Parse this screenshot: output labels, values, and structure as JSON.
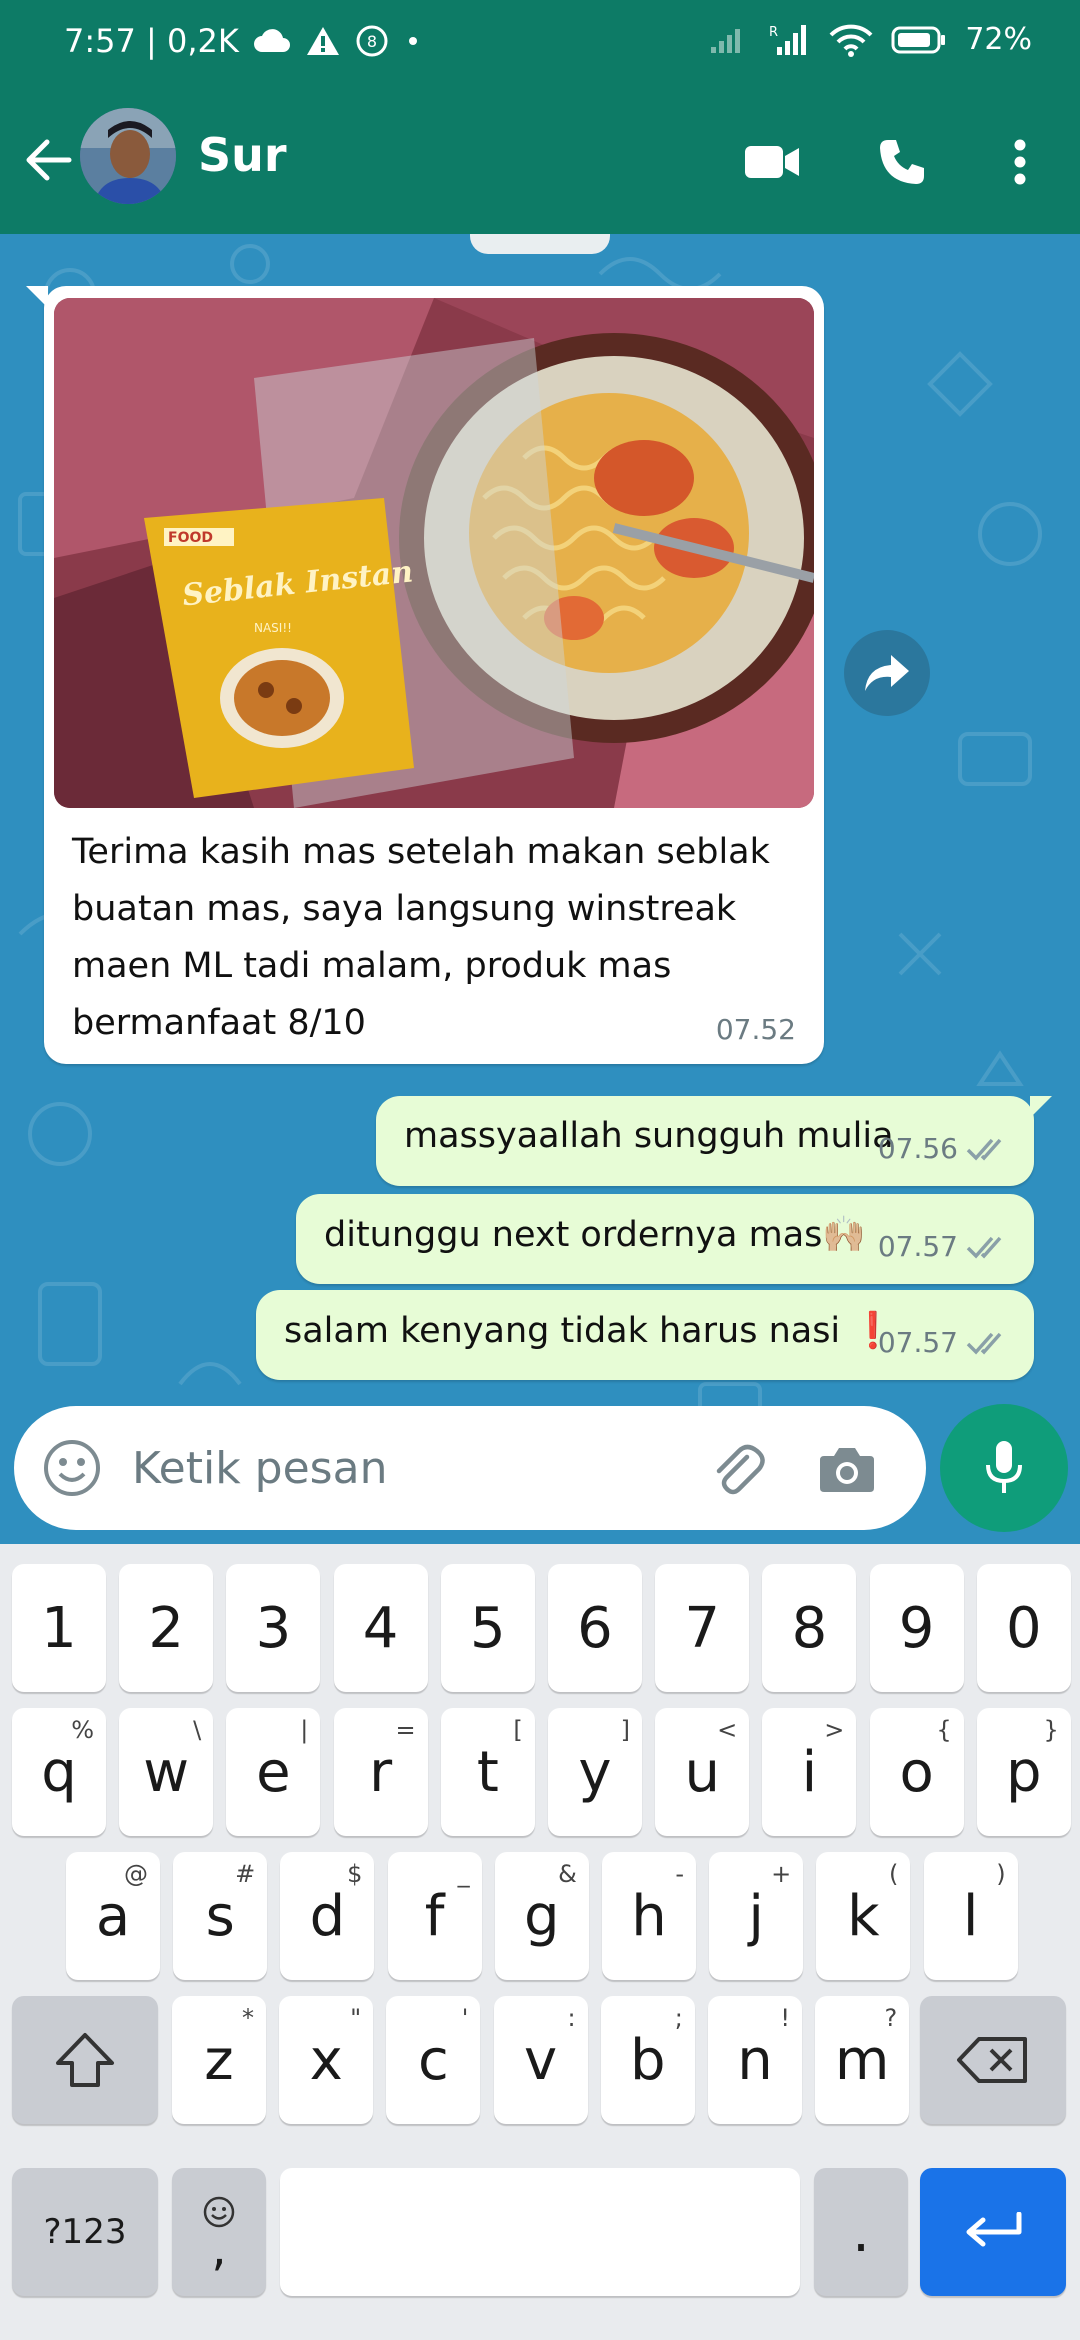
{
  "status_bar": {
    "time_info": "7:57 | 0,2K",
    "battery": "72%",
    "icons": [
      "cloud-icon",
      "warning-icon",
      "data-saver-icon",
      "dot-icon",
      "signal-icon",
      "signal-r-icon",
      "wifi-icon",
      "battery-icon"
    ]
  },
  "app_bar": {
    "contact_name": "Sur",
    "icons": [
      "back-arrow-icon",
      "video-call-icon",
      "phone-icon",
      "more-vert-icon"
    ]
  },
  "chat": {
    "incoming": {
      "text": "Terima kasih mas setelah makan seblak buatan mas, saya langsung winstreak maen ML tadi malam, produk mas bermanfaat 8/10",
      "time": "07.52",
      "photo_label_brand": "FOOD",
      "photo_label_title": "Seblak Instan",
      "photo_label_sub": "NASI!!"
    },
    "outgoing": [
      {
        "text": "massyaallah sungguh mulia",
        "time": "07.56"
      },
      {
        "text": "ditunggu next ordernya mas🙌🏼",
        "time": "07.57"
      },
      {
        "text": "salam kenyang tidak harus nasi ❗",
        "time": "07.57"
      }
    ]
  },
  "composer": {
    "placeholder": "Ketik pesan"
  },
  "keyboard": {
    "row1": [
      {
        "k": "1"
      },
      {
        "k": "2"
      },
      {
        "k": "3"
      },
      {
        "k": "4"
      },
      {
        "k": "5"
      },
      {
        "k": "6"
      },
      {
        "k": "7"
      },
      {
        "k": "8"
      },
      {
        "k": "9"
      },
      {
        "k": "0"
      }
    ],
    "row2": [
      {
        "k": "q",
        "s": "%"
      },
      {
        "k": "w",
        "s": "\\"
      },
      {
        "k": "e",
        "s": "|"
      },
      {
        "k": "r",
        "s": "="
      },
      {
        "k": "t",
        "s": "["
      },
      {
        "k": "y",
        "s": "]"
      },
      {
        "k": "u",
        "s": "<"
      },
      {
        "k": "i",
        "s": ">"
      },
      {
        "k": "o",
        "s": "{"
      },
      {
        "k": "p",
        "s": "}"
      }
    ],
    "row3": [
      {
        "k": "a",
        "s": "@"
      },
      {
        "k": "s",
        "s": "#"
      },
      {
        "k": "d",
        "s": "$"
      },
      {
        "k": "f",
        "s": "_"
      },
      {
        "k": "g",
        "s": "&"
      },
      {
        "k": "h",
        "s": "-"
      },
      {
        "k": "j",
        "s": "+"
      },
      {
        "k": "k",
        "s": "("
      },
      {
        "k": "l",
        "s": ")"
      }
    ],
    "row4": [
      {
        "k": "z",
        "s": "*"
      },
      {
        "k": "x",
        "s": "\""
      },
      {
        "k": "c",
        "s": "'"
      },
      {
        "k": "v",
        "s": ":"
      },
      {
        "k": "b",
        "s": ";"
      },
      {
        "k": "n",
        "s": "!"
      },
      {
        "k": "m",
        "s": "?"
      }
    ],
    "symbols_label": "?123",
    "comma_label": ",",
    "period_label": "."
  },
  "colors": {
    "header": "#0d7b66",
    "chat_bg": "#2f8fbf",
    "outgoing_bubble": "#e7fcd6",
    "mic_button": "#0f9d7a",
    "read_ticks": "#8aa0a8",
    "enter_key": "#1a73e8"
  }
}
